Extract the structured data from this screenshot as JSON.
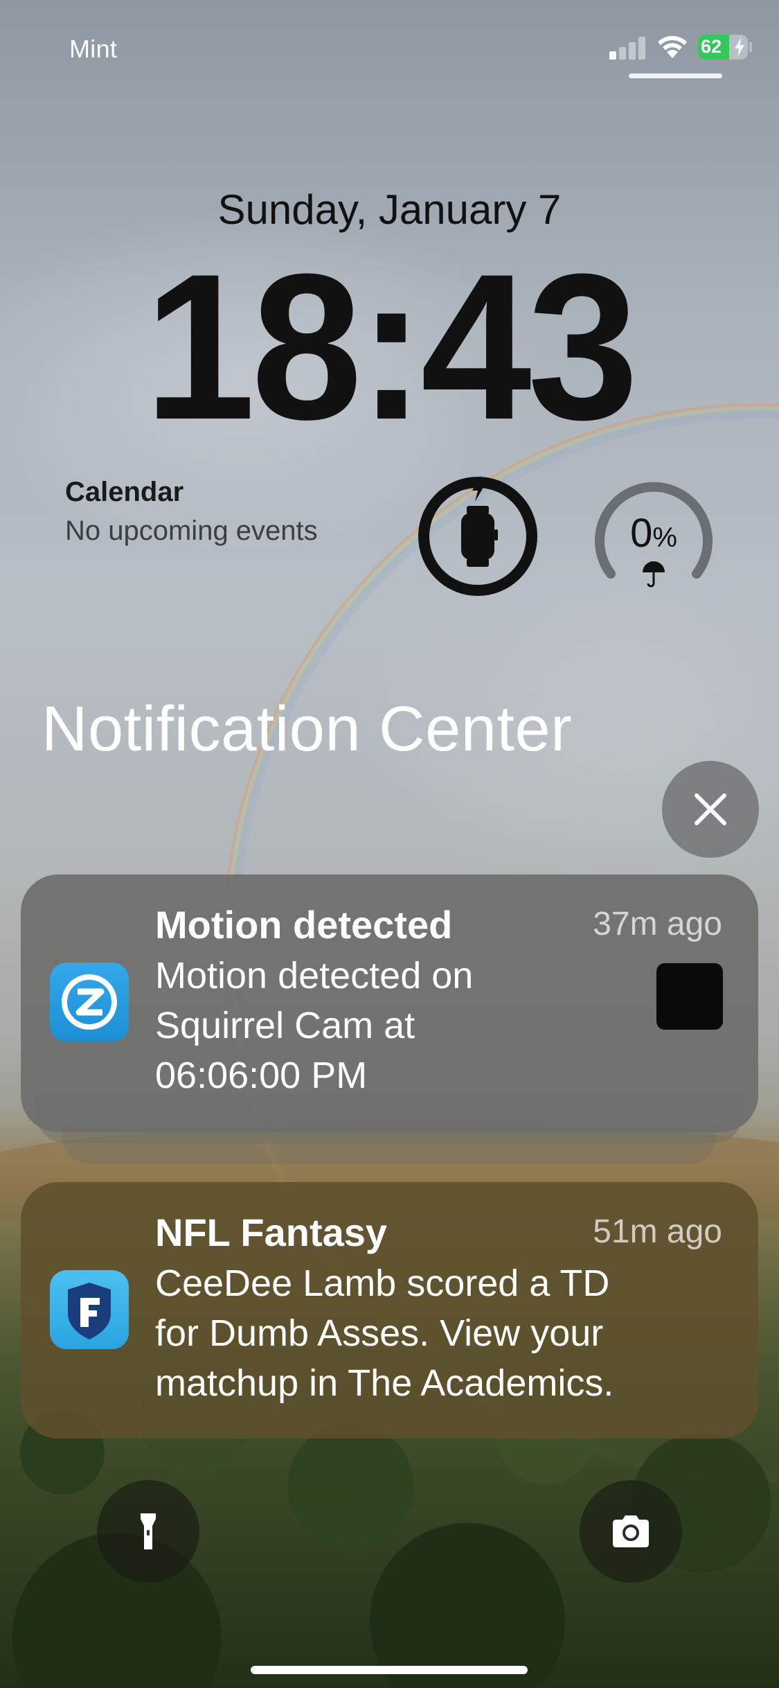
{
  "status_bar": {
    "carrier": "Mint",
    "battery_percent": "62",
    "battery_level": 0.62,
    "battery_color": "#34c759",
    "signal_bars_active": 1,
    "signal_bars_total": 4
  },
  "lock_screen": {
    "date": "Sunday, January 7",
    "time": "18:43"
  },
  "widgets": {
    "calendar": {
      "title": "Calendar",
      "subtitle": "No upcoming events"
    },
    "watch_battery": {
      "icon": "apple-watch-icon",
      "charging_icon": "bolt-icon"
    },
    "rain_chance": {
      "value": "0",
      "unit": "%",
      "icon": "umbrella-icon"
    }
  },
  "notification_center": {
    "title": "Notification Center",
    "clear_icon": "close-icon",
    "notifications": [
      {
        "app_icon": "zmodo-app-icon",
        "title": "Motion detected",
        "time": "37m ago",
        "body": "Motion detected on\nSquirrel Cam at\n06:06:00 PM",
        "has_thumbnail": true
      },
      {
        "app_icon": "nfl-fantasy-app-icon",
        "title": "NFL Fantasy",
        "time": "51m ago",
        "body": "CeeDee Lamb scored a TD\nfor Dumb Asses. View your\nmatchup in The Academics."
      }
    ]
  },
  "quick_actions": {
    "flashlight_icon": "flashlight-icon",
    "camera_icon": "camera-icon"
  }
}
